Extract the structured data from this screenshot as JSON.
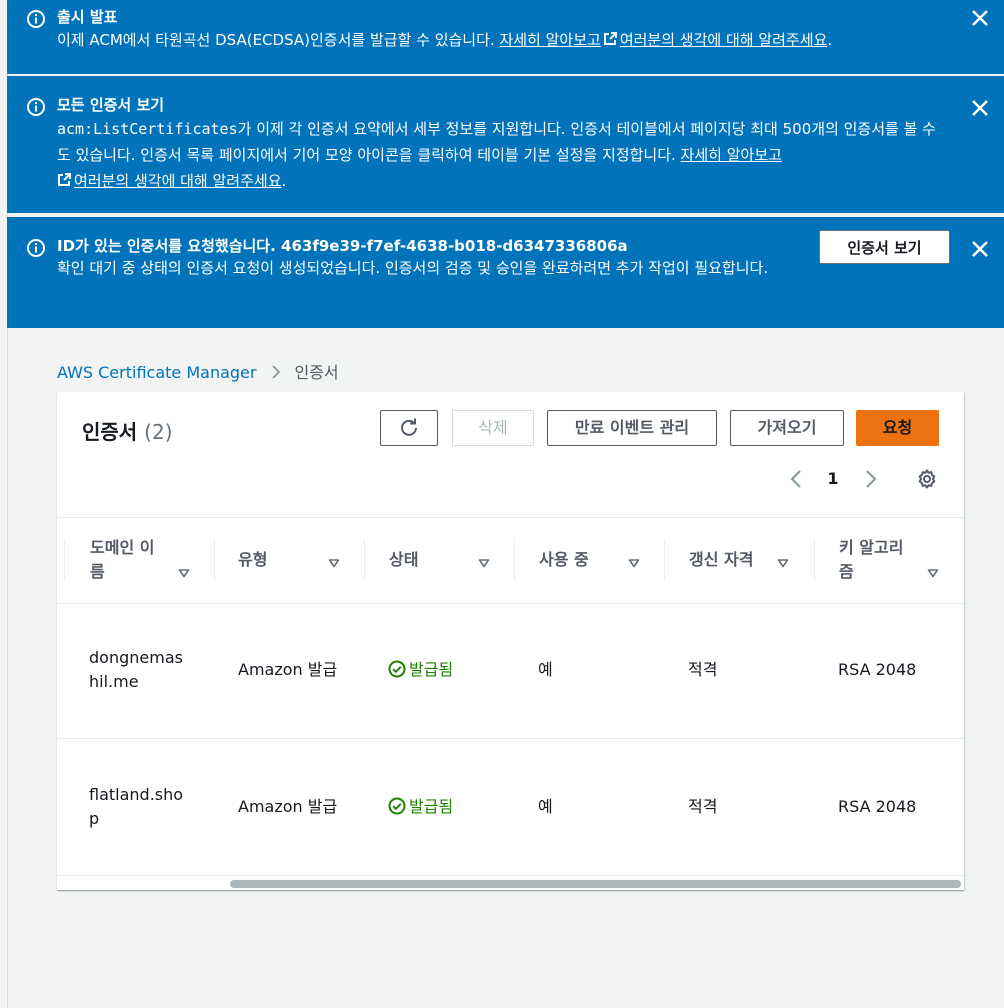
{
  "flash_launch": {
    "title": "출시 발표",
    "text": "이제 ACM에서 타원곡선 DSA(ECDSA)인증서를 발급할 수 있습니다.",
    "learn_more": "자세히 알아보고",
    "feedback": "여러분의 생각에 대해 알려주세요",
    "period": "."
  },
  "flash_list": {
    "title": "모든 인증서 보기",
    "api": "acm:ListCertificates",
    "text1": "가 이제 각 인증서 요약에서 세부 정보를 지원합니다. 인증서 테이블에서 페이지당 최대 500개의 인증서를 볼 수도 있습니다. 인증서 목록 페이지에서 기어 모양 아이콘을 클릭하여 테이블 기본 설정을 지정합니다.",
    "learn_more": "자세히 알아보고",
    "feedback": "여러분의 생각에 대해 알려주세요",
    "period": "."
  },
  "flash_request": {
    "title": "ID가 있는 인증서를 요청했습니다. 463f9e39-f7ef-4638-b018-d6347336806a",
    "text": "확인 대기 중 상태의 인증서 요청이 생성되었습니다. 인증서의 검증 및 승인을 완료하려면 추가 작업이 필요합니다.",
    "view_button": "인증서 보기"
  },
  "breadcrumb": {
    "root": "AWS Certificate Manager",
    "current": "인증서"
  },
  "panel": {
    "title": "인증서",
    "count": "(2)",
    "delete_label": "삭제",
    "expiry_label": "만료 이벤트 관리",
    "import_label": "가져오기",
    "request_label": "요청",
    "page": "1"
  },
  "columns": [
    "도메인 이름",
    "유형",
    "상태",
    "사용 중",
    "갱신 자격",
    "키 알고리즘"
  ],
  "rows": [
    {
      "domain": "dongnemashil.me",
      "type": "Amazon 발급",
      "status": "발급됨",
      "in_use": "예",
      "renewal": "적격",
      "key": "RSA 2048"
    },
    {
      "domain": "flatland.shop",
      "type": "Amazon 발급",
      "status": "발급됨",
      "in_use": "예",
      "renewal": "적격",
      "key": "RSA 2048"
    }
  ],
  "colors": {
    "flash": "#0073bb",
    "link": "#0073bb",
    "primary": "#ec7211",
    "success": "#1d8102"
  }
}
